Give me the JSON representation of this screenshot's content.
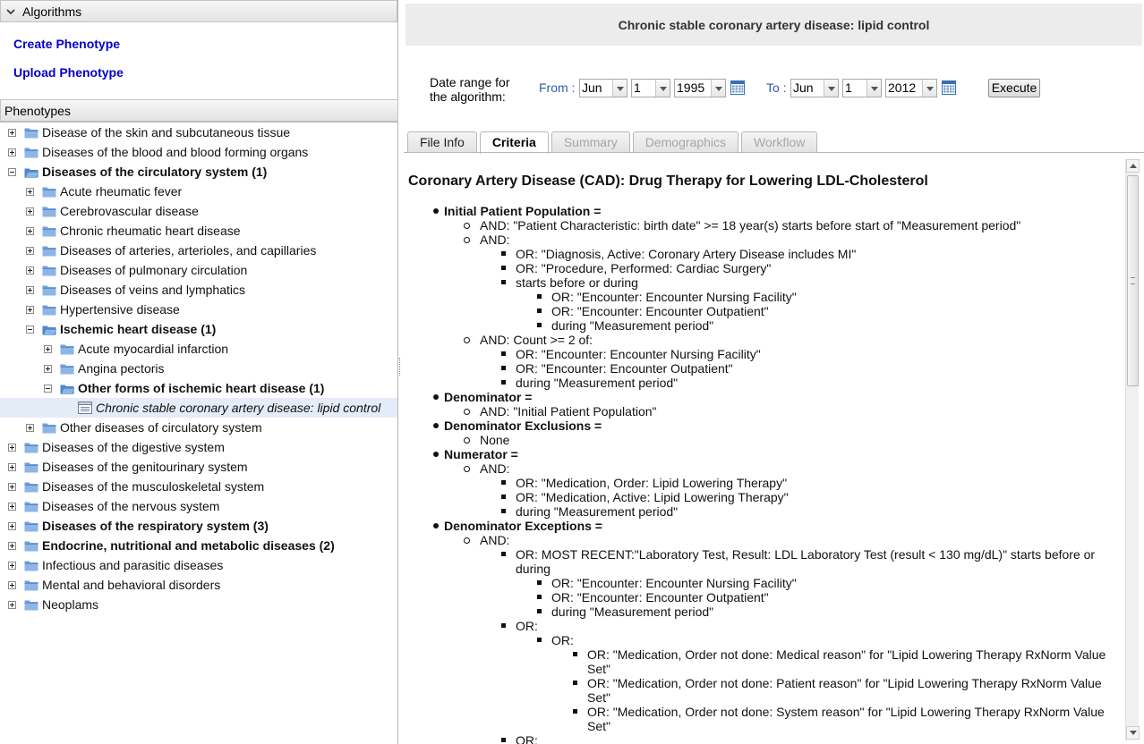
{
  "left": {
    "algorithms_header": "Algorithms",
    "links": [
      "Create Phenotype",
      "Upload Phenotype"
    ],
    "phenotypes_header": "Phenotypes",
    "tree": [
      {
        "label": "Disease of the skin and subcutaneous tissue",
        "depth": 0,
        "expander": "plus",
        "icon": "folder",
        "bold": false
      },
      {
        "label": "Diseases of the blood and blood forming organs",
        "depth": 0,
        "expander": "plus",
        "icon": "folder",
        "bold": false
      },
      {
        "label": "Diseases of the circulatory system (1)",
        "depth": 0,
        "expander": "minus",
        "icon": "folder-open",
        "bold": true
      },
      {
        "label": "Acute rheumatic fever",
        "depth": 1,
        "expander": "plus",
        "icon": "folder",
        "bold": false
      },
      {
        "label": "Cerebrovascular disease",
        "depth": 1,
        "expander": "plus",
        "icon": "folder",
        "bold": false
      },
      {
        "label": "Chronic rheumatic heart disease",
        "depth": 1,
        "expander": "plus",
        "icon": "folder",
        "bold": false
      },
      {
        "label": "Diseases of arteries, arterioles, and capillaries",
        "depth": 1,
        "expander": "plus",
        "icon": "folder",
        "bold": false
      },
      {
        "label": "Diseases of pulmonary circulation",
        "depth": 1,
        "expander": "plus",
        "icon": "folder",
        "bold": false
      },
      {
        "label": "Diseases of veins and lymphatics",
        "depth": 1,
        "expander": "plus",
        "icon": "folder",
        "bold": false
      },
      {
        "label": "Hypertensive disease",
        "depth": 1,
        "expander": "plus",
        "icon": "folder",
        "bold": false
      },
      {
        "label": "Ischemic heart disease (1)",
        "depth": 1,
        "expander": "minus",
        "icon": "folder-open",
        "bold": true
      },
      {
        "label": "Acute myocardial infarction",
        "depth": 2,
        "expander": "plus",
        "icon": "folder",
        "bold": false
      },
      {
        "label": "Angina pectoris",
        "depth": 2,
        "expander": "plus",
        "icon": "folder",
        "bold": false
      },
      {
        "label": "Other forms of ischemic heart disease (1)",
        "depth": 2,
        "expander": "minus",
        "icon": "folder-open",
        "bold": true
      },
      {
        "label": "Chronic stable coronary artery disease: lipid control",
        "depth": 3,
        "expander": "none",
        "icon": "document",
        "bold": false,
        "selected": true
      },
      {
        "label": "Other diseases of circulatory system",
        "depth": 1,
        "expander": "plus",
        "icon": "folder",
        "bold": false
      },
      {
        "label": "Diseases of the digestive system",
        "depth": 0,
        "expander": "plus",
        "icon": "folder",
        "bold": false
      },
      {
        "label": "Diseases of the genitourinary system",
        "depth": 0,
        "expander": "plus",
        "icon": "folder",
        "bold": false
      },
      {
        "label": "Diseases of the musculoskeletal system",
        "depth": 0,
        "expander": "plus",
        "icon": "folder",
        "bold": false
      },
      {
        "label": "Diseases of the nervous system",
        "depth": 0,
        "expander": "plus",
        "icon": "folder",
        "bold": false
      },
      {
        "label": "Diseases of the respiratory system (3)",
        "depth": 0,
        "expander": "plus",
        "icon": "folder",
        "bold": true
      },
      {
        "label": "Endocrine, nutritional and metabolic diseases (2)",
        "depth": 0,
        "expander": "plus",
        "icon": "folder",
        "bold": true
      },
      {
        "label": "Infectious and parasitic diseases",
        "depth": 0,
        "expander": "plus",
        "icon": "folder",
        "bold": false
      },
      {
        "label": "Mental and behavioral disorders",
        "depth": 0,
        "expander": "plus",
        "icon": "folder",
        "bold": false
      },
      {
        "label": "Neoplams",
        "depth": 0,
        "expander": "plus",
        "icon": "folder",
        "bold": false
      }
    ]
  },
  "right": {
    "title": "Chronic stable coronary artery disease: lipid control",
    "date_range": {
      "label_line1": "Date range for",
      "label_line2": "the algorithm:",
      "from_label": "From :",
      "from_month": "Jun",
      "from_day": "1",
      "from_year": "1995",
      "to_label": "To :",
      "to_month": "Jun",
      "to_day": "1",
      "to_year": "2012",
      "execute": "Execute"
    },
    "tabs": [
      {
        "label": "File Info",
        "state": "normal"
      },
      {
        "label": "Criteria",
        "state": "active"
      },
      {
        "label": "Summary",
        "state": "disabled"
      },
      {
        "label": "Demographics",
        "state": "disabled"
      },
      {
        "label": "Workflow",
        "state": "disabled"
      }
    ],
    "criteria_title": "Coronary Artery Disease (CAD): Drug Therapy for Lowering LDL-Cholesterol",
    "criteria": [
      {
        "level": 0,
        "text": "Initial Patient Population ="
      },
      {
        "level": 1,
        "text": "AND: \"Patient Characteristic: birth date\" >= 18 year(s) starts before start of \"Measurement period\""
      },
      {
        "level": 1,
        "text": "AND:"
      },
      {
        "level": 2,
        "text": "OR: \"Diagnosis, Active: Coronary Artery Disease includes MI\""
      },
      {
        "level": 2,
        "text": "OR: \"Procedure, Performed: Cardiac Surgery\""
      },
      {
        "level": 2,
        "text": "starts before or during"
      },
      {
        "level": 3,
        "text": "OR: \"Encounter: Encounter Nursing Facility\""
      },
      {
        "level": 3,
        "text": "OR: \"Encounter: Encounter Outpatient\""
      },
      {
        "level": 3,
        "text": "during \"Measurement period\""
      },
      {
        "level": 1,
        "text": "AND: Count >= 2 of:"
      },
      {
        "level": 2,
        "text": "OR: \"Encounter: Encounter Nursing Facility\""
      },
      {
        "level": 2,
        "text": "OR: \"Encounter: Encounter Outpatient\""
      },
      {
        "level": 2,
        "text": "during \"Measurement period\""
      },
      {
        "level": 0,
        "text": "Denominator ="
      },
      {
        "level": 1,
        "text": "AND: \"Initial Patient Population\""
      },
      {
        "level": 0,
        "text": "Denominator Exclusions ="
      },
      {
        "level": 1,
        "text": "None"
      },
      {
        "level": 0,
        "text": "Numerator ="
      },
      {
        "level": 1,
        "text": "AND:"
      },
      {
        "level": 2,
        "text": "OR: \"Medication, Order: Lipid Lowering Therapy\""
      },
      {
        "level": 2,
        "text": "OR: \"Medication, Active: Lipid Lowering Therapy\""
      },
      {
        "level": 2,
        "text": "during \"Measurement period\""
      },
      {
        "level": 0,
        "text": "Denominator Exceptions ="
      },
      {
        "level": 1,
        "text": "AND:"
      },
      {
        "level": 2,
        "text": "OR: MOST RECENT:\"Laboratory Test, Result: LDL Laboratory Test (result < 130 mg/dL)\" starts before or during"
      },
      {
        "level": 3,
        "text": "OR: \"Encounter: Encounter Nursing Facility\""
      },
      {
        "level": 3,
        "text": "OR: \"Encounter: Encounter Outpatient\""
      },
      {
        "level": 3,
        "text": "during \"Measurement period\""
      },
      {
        "level": 2,
        "text": "OR:"
      },
      {
        "level": 3,
        "text": "OR:"
      },
      {
        "level": 4,
        "text": "OR: \"Medication, Order not done: Medical reason\" for \"Lipid Lowering Therapy RxNorm Value Set\""
      },
      {
        "level": 4,
        "text": "OR: \"Medication, Order not done: Patient reason\" for \"Lipid Lowering Therapy RxNorm Value Set\""
      },
      {
        "level": 4,
        "text": "OR: \"Medication, Order not done: System reason\" for \"Lipid Lowering Therapy RxNorm Value Set\""
      },
      {
        "level": 2,
        "text": "OR:"
      }
    ]
  },
  "colors": {
    "link": "#0000cc",
    "blue_label": "#2b5dab",
    "title_bar": "#ececec",
    "folder": "#6f9ed8",
    "selected_row": "#e4ecf7"
  }
}
